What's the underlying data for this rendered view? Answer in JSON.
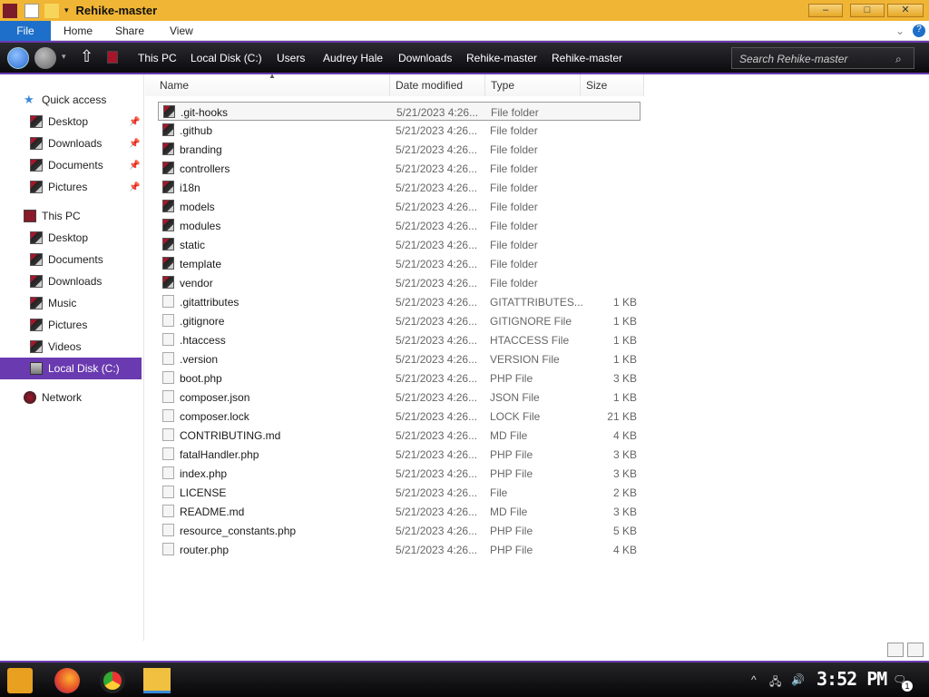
{
  "window": {
    "title": "Rehike-master",
    "minimize": "–",
    "maximize": "□",
    "close": "✕"
  },
  "ribbon": {
    "tabs": [
      "File",
      "Home",
      "Share",
      "View"
    ],
    "help": "?",
    "expand": "⌄"
  },
  "address": {
    "crumbs": [
      "This PC",
      "Local Disk (C:)",
      "Users",
      "Audrey Hale",
      "Downloads",
      "Rehike-master",
      "Rehike-master"
    ],
    "search_placeholder": "Search Rehike-master"
  },
  "sidebar": {
    "quick_access": "Quick access",
    "quick_items": [
      "Desktop",
      "Downloads",
      "Documents",
      "Pictures"
    ],
    "this_pc": "This PC",
    "pc_items": [
      "Desktop",
      "Documents",
      "Downloads",
      "Music",
      "Pictures",
      "Videos",
      "Local Disk (C:)"
    ],
    "network": "Network"
  },
  "columns": {
    "name": "Name",
    "date": "Date modified",
    "type": "Type",
    "size": "Size"
  },
  "files": [
    {
      "name": ".git-hooks",
      "date": "5/21/2023 4:26...",
      "type": "File folder",
      "size": "",
      "folder": true
    },
    {
      "name": ".github",
      "date": "5/21/2023 4:26...",
      "type": "File folder",
      "size": "",
      "folder": true
    },
    {
      "name": "branding",
      "date": "5/21/2023 4:26...",
      "type": "File folder",
      "size": "",
      "folder": true
    },
    {
      "name": "controllers",
      "date": "5/21/2023 4:26...",
      "type": "File folder",
      "size": "",
      "folder": true
    },
    {
      "name": "i18n",
      "date": "5/21/2023 4:26...",
      "type": "File folder",
      "size": "",
      "folder": true
    },
    {
      "name": "models",
      "date": "5/21/2023 4:26...",
      "type": "File folder",
      "size": "",
      "folder": true
    },
    {
      "name": "modules",
      "date": "5/21/2023 4:26...",
      "type": "File folder",
      "size": "",
      "folder": true
    },
    {
      "name": "static",
      "date": "5/21/2023 4:26...",
      "type": "File folder",
      "size": "",
      "folder": true
    },
    {
      "name": "template",
      "date": "5/21/2023 4:26...",
      "type": "File folder",
      "size": "",
      "folder": true
    },
    {
      "name": "vendor",
      "date": "5/21/2023 4:26...",
      "type": "File folder",
      "size": "",
      "folder": true
    },
    {
      "name": ".gitattributes",
      "date": "5/21/2023 4:26...",
      "type": "GITATTRIBUTES...",
      "size": "1 KB",
      "folder": false
    },
    {
      "name": ".gitignore",
      "date": "5/21/2023 4:26...",
      "type": "GITIGNORE File",
      "size": "1 KB",
      "folder": false
    },
    {
      "name": ".htaccess",
      "date": "5/21/2023 4:26...",
      "type": "HTACCESS File",
      "size": "1 KB",
      "folder": false
    },
    {
      "name": ".version",
      "date": "5/21/2023 4:26...",
      "type": "VERSION File",
      "size": "1 KB",
      "folder": false
    },
    {
      "name": "boot.php",
      "date": "5/21/2023 4:26...",
      "type": "PHP File",
      "size": "3 KB",
      "folder": false
    },
    {
      "name": "composer.json",
      "date": "5/21/2023 4:26...",
      "type": "JSON File",
      "size": "1 KB",
      "folder": false
    },
    {
      "name": "composer.lock",
      "date": "5/21/2023 4:26...",
      "type": "LOCK File",
      "size": "21 KB",
      "folder": false
    },
    {
      "name": "CONTRIBUTING.md",
      "date": "5/21/2023 4:26...",
      "type": "MD File",
      "size": "4 KB",
      "folder": false
    },
    {
      "name": "fatalHandler.php",
      "date": "5/21/2023 4:26...",
      "type": "PHP File",
      "size": "3 KB",
      "folder": false
    },
    {
      "name": "index.php",
      "date": "5/21/2023 4:26...",
      "type": "PHP File",
      "size": "3 KB",
      "folder": false
    },
    {
      "name": "LICENSE",
      "date": "5/21/2023 4:26...",
      "type": "File",
      "size": "2 KB",
      "folder": false
    },
    {
      "name": "README.md",
      "date": "5/21/2023 4:26...",
      "type": "MD File",
      "size": "3 KB",
      "folder": false
    },
    {
      "name": "resource_constants.php",
      "date": "5/21/2023 4:26...",
      "type": "PHP File",
      "size": "5 KB",
      "folder": false
    },
    {
      "name": "router.php",
      "date": "5/21/2023 4:26...",
      "type": "PHP File",
      "size": "4 KB",
      "folder": false
    }
  ],
  "taskbar": {
    "clock": "3:52 PM",
    "notifications": "1"
  },
  "colors": {
    "title": "#f0b534",
    "accent": "#6a3ab0",
    "selected_nav": "#6a3ab0",
    "file_tab": "#1e6fc9"
  }
}
